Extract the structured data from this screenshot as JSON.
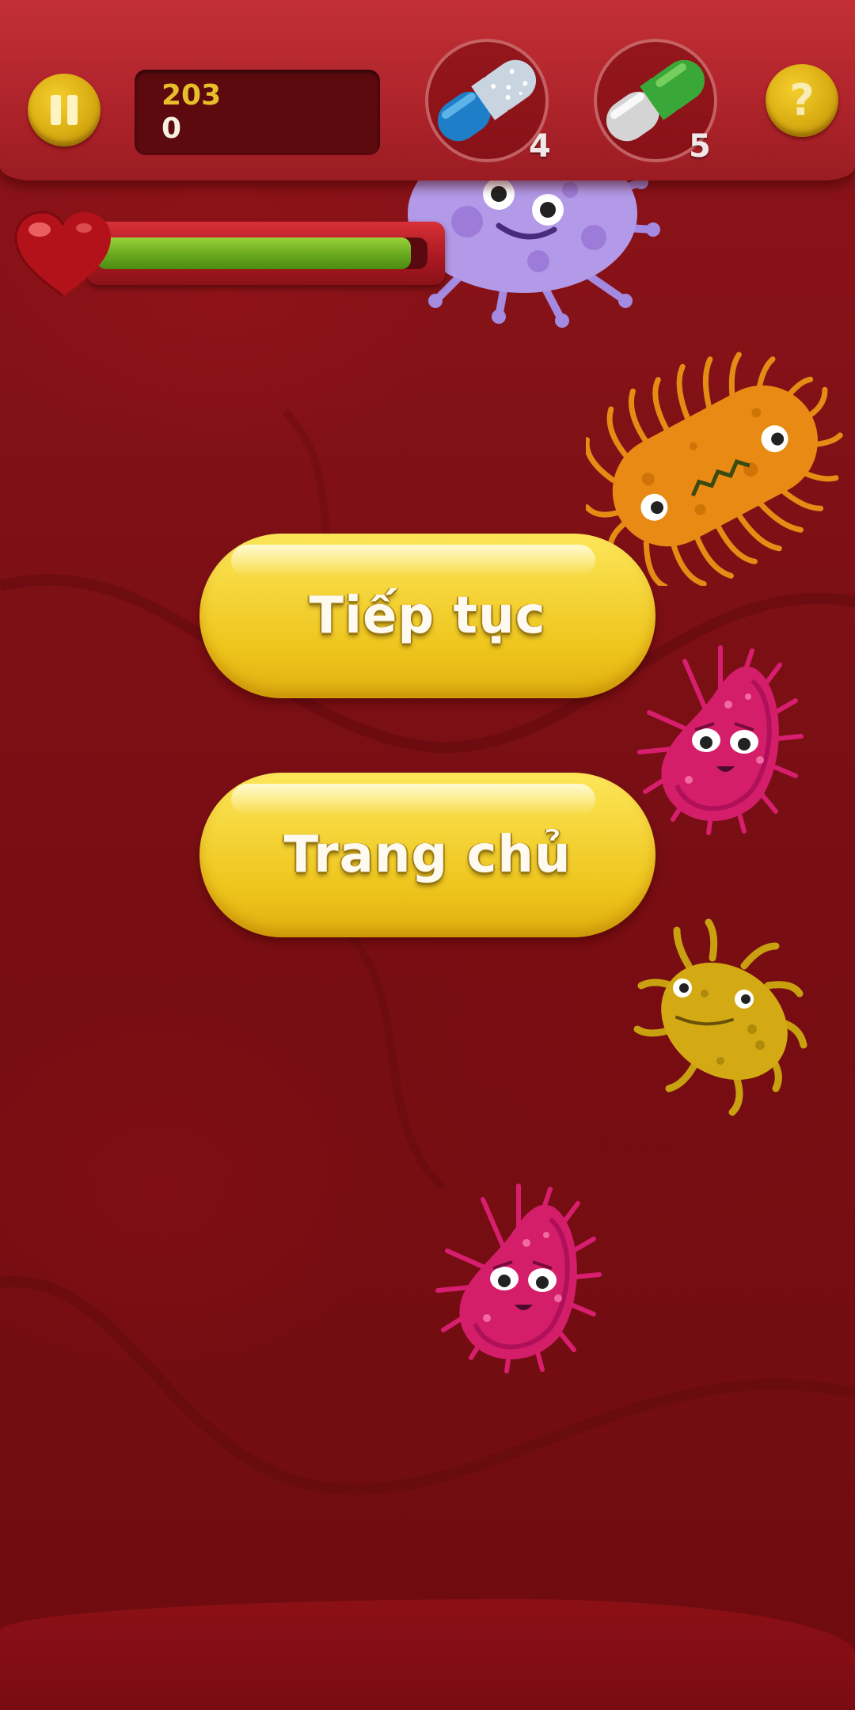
{
  "hud": {
    "score_top": "203",
    "score_bottom": "0",
    "pill_blue_count": "4",
    "pill_green_count": "5",
    "help_glyph": "?"
  },
  "health": {
    "fill_fraction": 0.95,
    "bar_color": "#6aab1e"
  },
  "menu": {
    "continue_label": "Tiếp tục",
    "home_label": "Trang chủ"
  },
  "icons": {
    "pause": "pause-icon",
    "help": "question-mark-icon",
    "heart": "heart-icon",
    "pill_blue": "blue-pill-icon",
    "pill_green": "green-pill-icon"
  },
  "colors": {
    "hud_red": "#b0242b",
    "background": "#7a0f14",
    "button_yellow": "#f5d53a",
    "gold": "#d9ac12"
  }
}
